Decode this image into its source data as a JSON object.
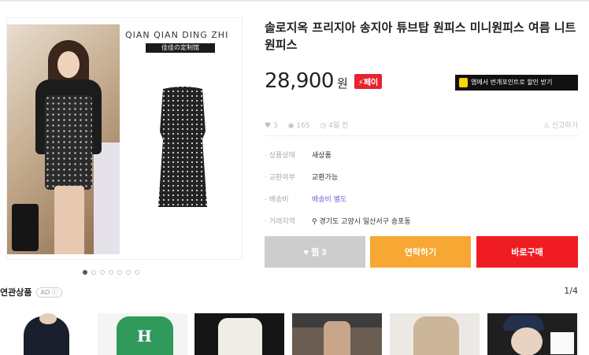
{
  "product": {
    "title": "솔로지옥 프리지아 송지아 튜브탑 원피스 미니원피스 여름 니트 원피스",
    "price": "28,900",
    "currency": "원",
    "pay_badge": "⚡페이",
    "brand_text": "QIAN QIAN DING ZHI",
    "brand_badge": "佳佳の定制馆"
  },
  "promo": {
    "label": "앱에서 번개포인트로 할인 받기"
  },
  "meta": {
    "likes": "3",
    "views": "165",
    "time": "4일 전",
    "report": "신고하기"
  },
  "info": [
    {
      "label": "상품상태",
      "value": "새상품"
    },
    {
      "label": "교환여부",
      "value": "교환가능"
    },
    {
      "label": "배송비",
      "value": "배송비 별도"
    },
    {
      "label": "거래지역",
      "value": "경기도 고양시 일산서구 송포동"
    }
  ],
  "buttons": {
    "like": "♥ 찜 3",
    "contact": "연락하기",
    "buy": "바로구매"
  },
  "related": {
    "label": "연관상품",
    "ad": "AD ⓘ",
    "page": "1/4",
    "thumb_text": ""
  },
  "colors": {
    "contact": "#f7a733",
    "buy": "#ef1c24",
    "like": "#cdcdcd",
    "pay": "#e8222e"
  }
}
